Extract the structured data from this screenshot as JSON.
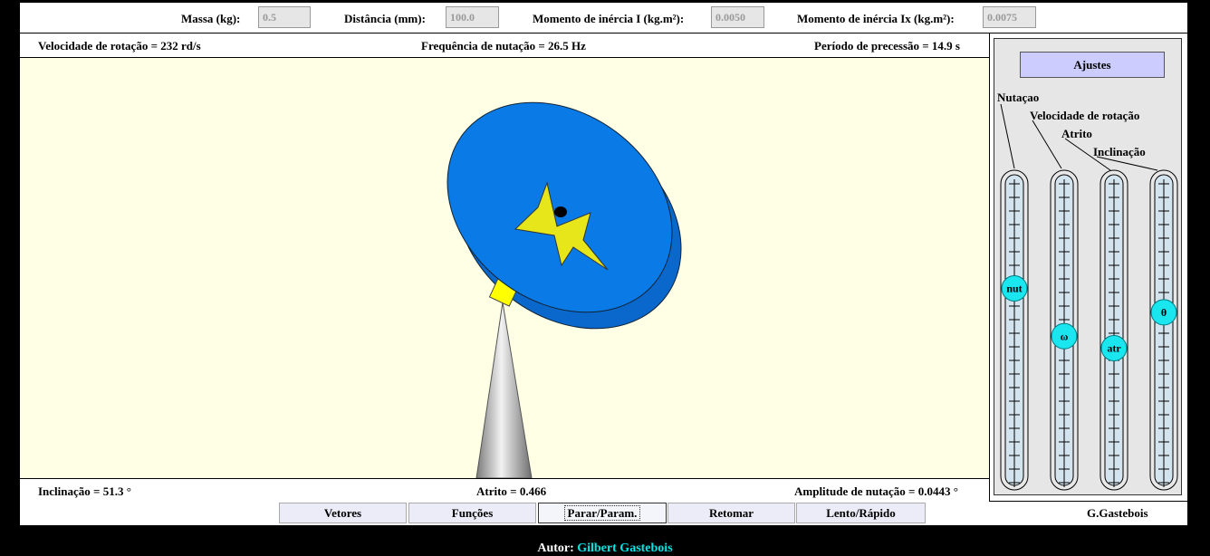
{
  "params": {
    "mass_label": "Massa (kg):",
    "mass_value": "0.5",
    "distance_label": "Distância (mm):",
    "distance_value": "100.0",
    "inertia_label": "Momento de inércia I (kg.m²):",
    "inertia_value": "0.0050",
    "inertia_x_label": "Momento de inércia Ix (kg.m²):",
    "inertia_x_value": "0.0075"
  },
  "info_top": {
    "rotation_speed": "Velocidade de rotação = 232 rd/s",
    "nutation_frequency": "Frequência de nutação = 26.5 Hz",
    "precession_period": "Período de precessão = 14.9 s"
  },
  "info_bottom": {
    "inclination": "Inclinação = 51.3 °",
    "friction": "Atrito = 0.466",
    "nutation_amplitude": "Amplitude de nutação = 0.0443 °"
  },
  "side": {
    "adjust_button": "Ajustes",
    "labels": [
      "Nutaçao",
      "Velocidade de rotação",
      "Atrito",
      "Inclinação"
    ],
    "sliders": [
      {
        "knob": "nut",
        "level": 0.65
      },
      {
        "knob": "ω",
        "level": 0.49
      },
      {
        "knob": "atr",
        "level": 0.45
      },
      {
        "knob": "θ",
        "level": 0.57
      }
    ]
  },
  "buttons": {
    "vectors": "Vetores",
    "functions": "Funções",
    "stop_params": "Parar/Param.",
    "resume": "Retomar",
    "speed": "Lento/Rápido",
    "credit": "G.Gastebois"
  },
  "footer": {
    "author_label": "Autor:",
    "author_name": "Gilbert Gastebois"
  },
  "colors": {
    "disk": "#0a7be6",
    "star": "#e6e61a",
    "knob": "#1ae6f0",
    "canvas": "#ffffe6"
  }
}
